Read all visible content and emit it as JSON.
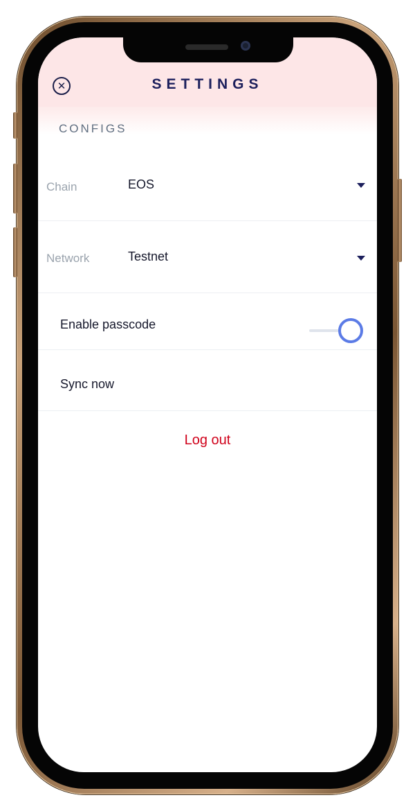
{
  "header": {
    "title": "SETTINGS",
    "close_icon": "close-circle-icon",
    "background": "#fde6e7",
    "title_color": "#1c1f5c"
  },
  "configs": {
    "section_title": "CONFIGS",
    "chain": {
      "label": "Chain",
      "value": "EOS",
      "icon": "caret-down-icon"
    },
    "network": {
      "label": "Network",
      "value": "Testnet",
      "icon": "caret-down-icon"
    }
  },
  "passcode": {
    "label": "Enable passcode",
    "enabled": true,
    "toggle_color": "#5b7be6"
  },
  "sync": {
    "label": "Sync now"
  },
  "logout": {
    "label": "Log out",
    "color": "#d0021b"
  }
}
